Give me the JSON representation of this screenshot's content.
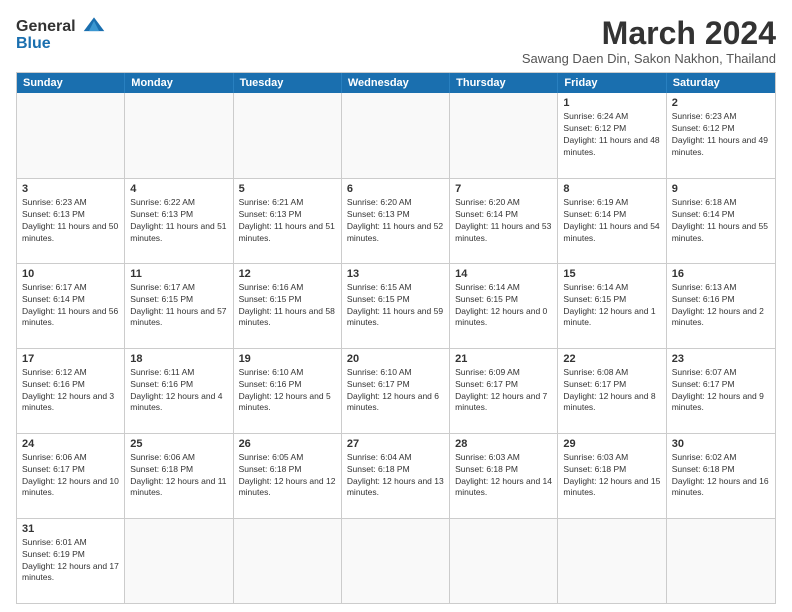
{
  "header": {
    "logo_general": "General",
    "logo_blue": "Blue",
    "month_title": "March 2024",
    "subtitle": "Sawang Daen Din, Sakon Nakhon, Thailand"
  },
  "calendar": {
    "days": [
      "Sunday",
      "Monday",
      "Tuesday",
      "Wednesday",
      "Thursday",
      "Friday",
      "Saturday"
    ],
    "rows": [
      [
        {
          "day": "",
          "info": ""
        },
        {
          "day": "",
          "info": ""
        },
        {
          "day": "",
          "info": ""
        },
        {
          "day": "",
          "info": ""
        },
        {
          "day": "",
          "info": ""
        },
        {
          "day": "1",
          "info": "Sunrise: 6:24 AM\nSunset: 6:12 PM\nDaylight: 11 hours and 48 minutes."
        },
        {
          "day": "2",
          "info": "Sunrise: 6:23 AM\nSunset: 6:12 PM\nDaylight: 11 hours and 49 minutes."
        }
      ],
      [
        {
          "day": "3",
          "info": "Sunrise: 6:23 AM\nSunset: 6:13 PM\nDaylight: 11 hours and 50 minutes."
        },
        {
          "day": "4",
          "info": "Sunrise: 6:22 AM\nSunset: 6:13 PM\nDaylight: 11 hours and 51 minutes."
        },
        {
          "day": "5",
          "info": "Sunrise: 6:21 AM\nSunset: 6:13 PM\nDaylight: 11 hours and 51 minutes."
        },
        {
          "day": "6",
          "info": "Sunrise: 6:20 AM\nSunset: 6:13 PM\nDaylight: 11 hours and 52 minutes."
        },
        {
          "day": "7",
          "info": "Sunrise: 6:20 AM\nSunset: 6:14 PM\nDaylight: 11 hours and 53 minutes."
        },
        {
          "day": "8",
          "info": "Sunrise: 6:19 AM\nSunset: 6:14 PM\nDaylight: 11 hours and 54 minutes."
        },
        {
          "day": "9",
          "info": "Sunrise: 6:18 AM\nSunset: 6:14 PM\nDaylight: 11 hours and 55 minutes."
        }
      ],
      [
        {
          "day": "10",
          "info": "Sunrise: 6:17 AM\nSunset: 6:14 PM\nDaylight: 11 hours and 56 minutes."
        },
        {
          "day": "11",
          "info": "Sunrise: 6:17 AM\nSunset: 6:15 PM\nDaylight: 11 hours and 57 minutes."
        },
        {
          "day": "12",
          "info": "Sunrise: 6:16 AM\nSunset: 6:15 PM\nDaylight: 11 hours and 58 minutes."
        },
        {
          "day": "13",
          "info": "Sunrise: 6:15 AM\nSunset: 6:15 PM\nDaylight: 11 hours and 59 minutes."
        },
        {
          "day": "14",
          "info": "Sunrise: 6:14 AM\nSunset: 6:15 PM\nDaylight: 12 hours and 0 minutes."
        },
        {
          "day": "15",
          "info": "Sunrise: 6:14 AM\nSunset: 6:15 PM\nDaylight: 12 hours and 1 minute."
        },
        {
          "day": "16",
          "info": "Sunrise: 6:13 AM\nSunset: 6:16 PM\nDaylight: 12 hours and 2 minutes."
        }
      ],
      [
        {
          "day": "17",
          "info": "Sunrise: 6:12 AM\nSunset: 6:16 PM\nDaylight: 12 hours and 3 minutes."
        },
        {
          "day": "18",
          "info": "Sunrise: 6:11 AM\nSunset: 6:16 PM\nDaylight: 12 hours and 4 minutes."
        },
        {
          "day": "19",
          "info": "Sunrise: 6:10 AM\nSunset: 6:16 PM\nDaylight: 12 hours and 5 minutes."
        },
        {
          "day": "20",
          "info": "Sunrise: 6:10 AM\nSunset: 6:17 PM\nDaylight: 12 hours and 6 minutes."
        },
        {
          "day": "21",
          "info": "Sunrise: 6:09 AM\nSunset: 6:17 PM\nDaylight: 12 hours and 7 minutes."
        },
        {
          "day": "22",
          "info": "Sunrise: 6:08 AM\nSunset: 6:17 PM\nDaylight: 12 hours and 8 minutes."
        },
        {
          "day": "23",
          "info": "Sunrise: 6:07 AM\nSunset: 6:17 PM\nDaylight: 12 hours and 9 minutes."
        }
      ],
      [
        {
          "day": "24",
          "info": "Sunrise: 6:06 AM\nSunset: 6:17 PM\nDaylight: 12 hours and 10 minutes."
        },
        {
          "day": "25",
          "info": "Sunrise: 6:06 AM\nSunset: 6:18 PM\nDaylight: 12 hours and 11 minutes."
        },
        {
          "day": "26",
          "info": "Sunrise: 6:05 AM\nSunset: 6:18 PM\nDaylight: 12 hours and 12 minutes."
        },
        {
          "day": "27",
          "info": "Sunrise: 6:04 AM\nSunset: 6:18 PM\nDaylight: 12 hours and 13 minutes."
        },
        {
          "day": "28",
          "info": "Sunrise: 6:03 AM\nSunset: 6:18 PM\nDaylight: 12 hours and 14 minutes."
        },
        {
          "day": "29",
          "info": "Sunrise: 6:03 AM\nSunset: 6:18 PM\nDaylight: 12 hours and 15 minutes."
        },
        {
          "day": "30",
          "info": "Sunrise: 6:02 AM\nSunset: 6:18 PM\nDaylight: 12 hours and 16 minutes."
        }
      ],
      [
        {
          "day": "31",
          "info": "Sunrise: 6:01 AM\nSunset: 6:19 PM\nDaylight: 12 hours and 17 minutes."
        },
        {
          "day": "",
          "info": ""
        },
        {
          "day": "",
          "info": ""
        },
        {
          "day": "",
          "info": ""
        },
        {
          "day": "",
          "info": ""
        },
        {
          "day": "",
          "info": ""
        },
        {
          "day": "",
          "info": ""
        }
      ]
    ]
  }
}
